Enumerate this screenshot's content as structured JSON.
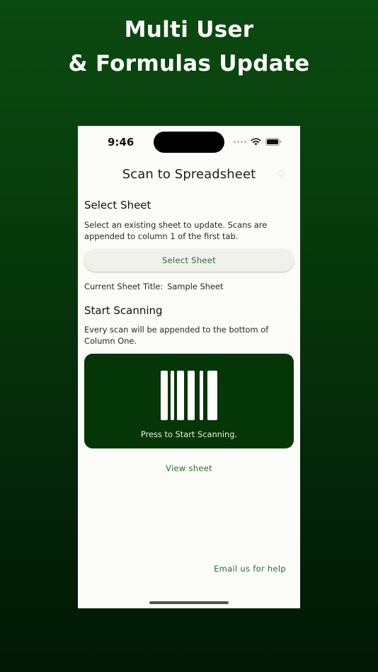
{
  "promo": {
    "line1": "Multi User",
    "line2": "& Formulas Update"
  },
  "status_bar": {
    "time": "9:46"
  },
  "header": {
    "title": "Scan to Spreadsheet"
  },
  "select_section": {
    "title": "Select Sheet",
    "description": "Select an existing sheet to update. Scans are appended to column 1 of the first tab.",
    "button_label": "Select Sheet",
    "current_label": "Current Sheet Title:",
    "current_value": "Sample Sheet"
  },
  "scan_section": {
    "title": "Start Scanning",
    "description": "Every scan will be appended to the bottom of Column One.",
    "panel_label": "Press to Start Scanning."
  },
  "links": {
    "view_sheet": "View sheet",
    "email_help": "Email us for help"
  },
  "colors": {
    "accent": "#2e6b2e",
    "scan_panel": "#053607",
    "screen_bg": "#fbfcf7"
  },
  "icons": {
    "header": "gear-icon",
    "scan": "barcode-icon"
  }
}
